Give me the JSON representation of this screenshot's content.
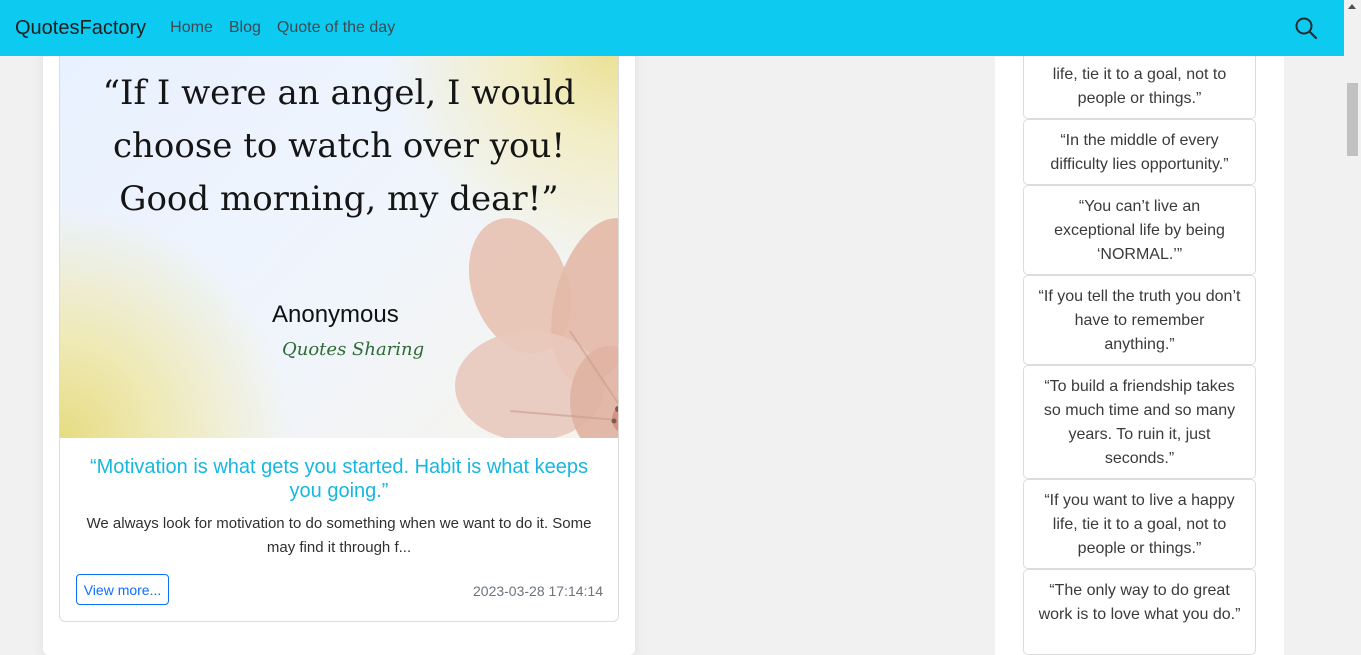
{
  "nav": {
    "brand": "QuotesFactory",
    "links": [
      "Home",
      "Blog",
      "Quote of the day"
    ],
    "search_icon": "search-icon"
  },
  "post": {
    "image": {
      "quote_lines": [
        "“If I were an angel, I would",
        "choose to watch over you!",
        "Good morning, my dear!”"
      ],
      "author": "Anonymous",
      "logo_text": "Quotes Sharing"
    },
    "title": "“Motivation is what gets you started. Habit is what keeps you going.”",
    "excerpt": "We always look for motivation to do something when we want to do it. Some may find it through f...",
    "view_more": "View more...",
    "date": "2023-03-28 17:14:14"
  },
  "sidebar": {
    "quotes": [
      "life, tie it to a goal, not to people or things.”",
      "“In the middle of every difficulty lies opportunity.”",
      "“You can’t live an exceptional life by being ‘NORMAL.’”",
      "“If you tell the truth you don’t have to remember anything.”",
      "“To build a friendship takes so much time and so many years. To ruin it, just seconds.”",
      "“If you want to live a happy life, tie it to a goal, not to people or things.”",
      "“The only way to do great work is to love what you do.”"
    ]
  },
  "colors": {
    "navbar": "#0dcaf0",
    "title_accent": "#17b7df",
    "button_outline": "#0d6efd"
  }
}
